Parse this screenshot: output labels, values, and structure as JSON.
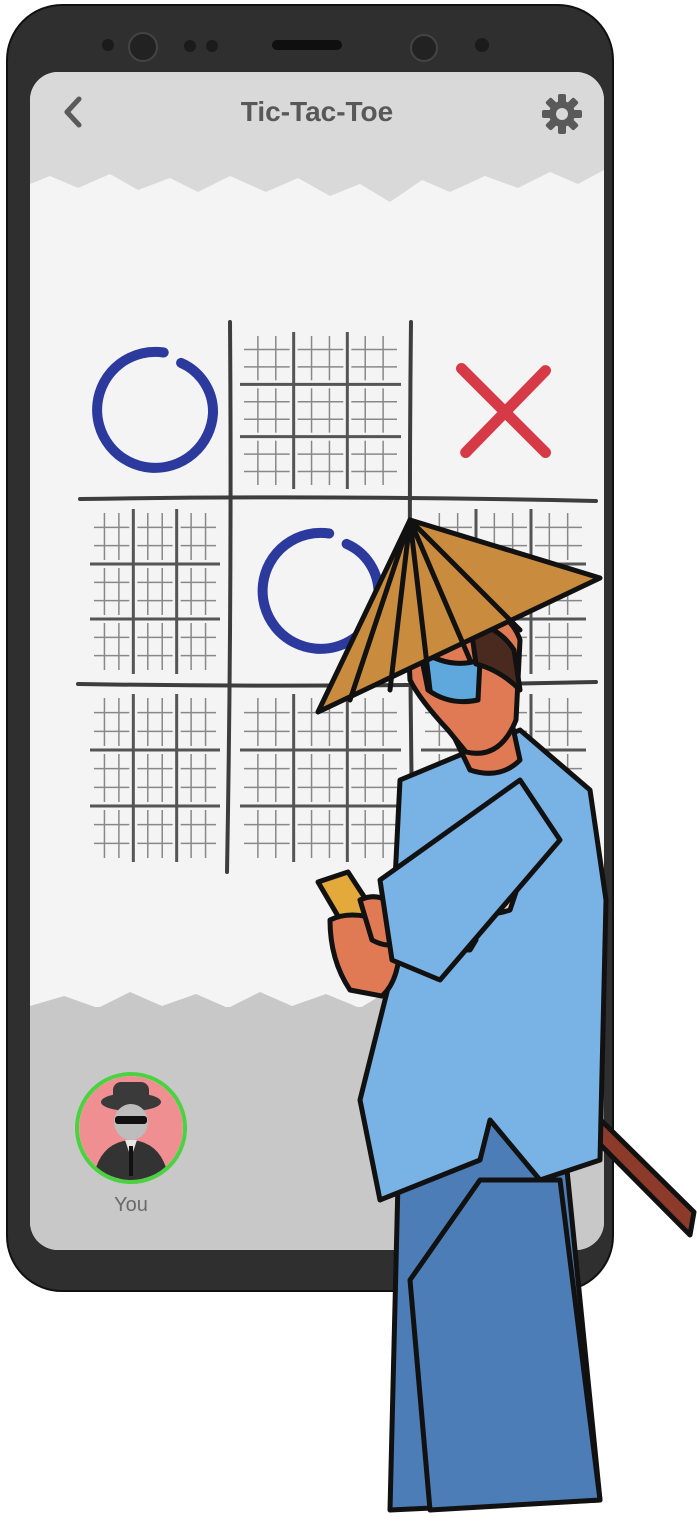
{
  "app": {
    "title": "Tic-Tac-Toe"
  },
  "icons": {
    "back": "chevron-left-icon",
    "settings": "gear-icon"
  },
  "board": {
    "cells": [
      "O",
      "sub",
      "X",
      "sub",
      "O",
      "sub",
      "sub",
      "sub",
      "sub"
    ]
  },
  "player": {
    "label": "You"
  },
  "colors": {
    "o": "#2b3a9c",
    "x": "#d63a47",
    "turn_ring": "#4ad240"
  }
}
